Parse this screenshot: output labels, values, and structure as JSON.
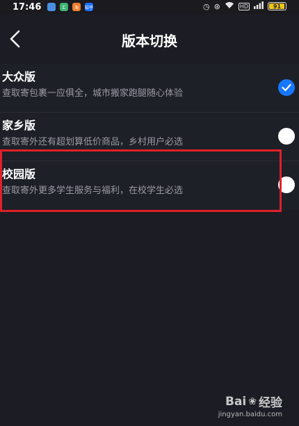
{
  "status_bar": {
    "time": "17:46",
    "apps": [
      {
        "icon": "app-blue-icon",
        "color": "#4a90e2",
        "label": ""
      },
      {
        "icon": "app-green-icon",
        "color": "#3cb371",
        "label": "汇"
      },
      {
        "icon": "app-orange-icon",
        "color": "#f07c2c",
        "label": "淘"
      },
      {
        "icon": "zhihu-icon",
        "color": "#1e6fff",
        "label": "知乎"
      }
    ],
    "battery": "91"
  },
  "nav": {
    "title": "版本切换"
  },
  "versions": [
    {
      "title": "大众版",
      "desc": "查取寄包裹一应俱全，城市搬家跑腿随心体验",
      "selected": true
    },
    {
      "title": "家乡版",
      "desc": "查取寄外还有超划算低价商品，乡村用户必选",
      "selected": false
    },
    {
      "title": "校园版",
      "desc": "查取寄外更多学生服务与福利，在校学生必选",
      "selected": false
    }
  ],
  "colors": {
    "accent": "#1677ff",
    "highlight": "#e0202a",
    "background": "#1c1c24"
  },
  "watermark": {
    "logo_a": "Bai",
    "logo_b": "经验",
    "url": "jingyan.baidu.com"
  }
}
